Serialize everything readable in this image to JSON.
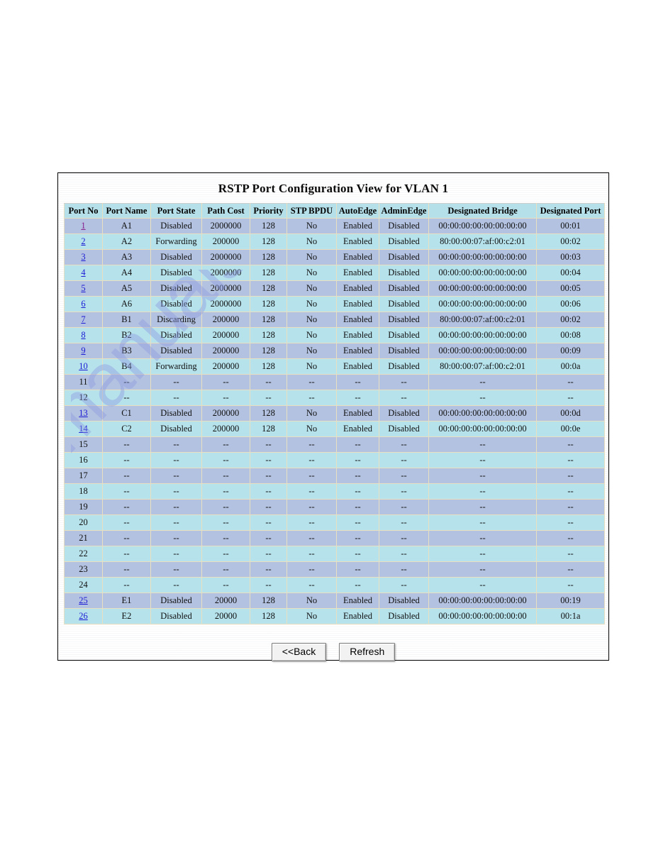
{
  "view": {
    "title": "RSTP Port Configuration View for VLAN 1"
  },
  "watermark": {
    "text": "manualshive.com"
  },
  "table": {
    "columns": [
      "Port No",
      "Port Name",
      "Port State",
      "Path Cost",
      "Priority",
      "STP BPDU",
      "AutoEdge",
      "AdminEdge",
      "Designated Bridge",
      "Designated Port"
    ],
    "empty_value": "--",
    "rows": [
      {
        "port_no": "1",
        "linked": true,
        "visited": true,
        "port_name": "A1",
        "port_state": "Disabled",
        "path_cost": "2000000",
        "priority": "128",
        "stp_bpdu": "No",
        "auto_edge": "Enabled",
        "admin_edge": "Disabled",
        "designated_bridge": "00:00:00:00:00:00:00:00",
        "designated_port": "00:01"
      },
      {
        "port_no": "2",
        "linked": true,
        "visited": false,
        "port_name": "A2",
        "port_state": "Forwarding",
        "path_cost": "200000",
        "priority": "128",
        "stp_bpdu": "No",
        "auto_edge": "Enabled",
        "admin_edge": "Disabled",
        "designated_bridge": "80:00:00:07:af:00:c2:01",
        "designated_port": "00:02"
      },
      {
        "port_no": "3",
        "linked": true,
        "visited": false,
        "port_name": "A3",
        "port_state": "Disabled",
        "path_cost": "2000000",
        "priority": "128",
        "stp_bpdu": "No",
        "auto_edge": "Enabled",
        "admin_edge": "Disabled",
        "designated_bridge": "00:00:00:00:00:00:00:00",
        "designated_port": "00:03"
      },
      {
        "port_no": "4",
        "linked": true,
        "visited": false,
        "port_name": "A4",
        "port_state": "Disabled",
        "path_cost": "2000000",
        "priority": "128",
        "stp_bpdu": "No",
        "auto_edge": "Enabled",
        "admin_edge": "Disabled",
        "designated_bridge": "00:00:00:00:00:00:00:00",
        "designated_port": "00:04"
      },
      {
        "port_no": "5",
        "linked": true,
        "visited": false,
        "port_name": "A5",
        "port_state": "Disabled",
        "path_cost": "2000000",
        "priority": "128",
        "stp_bpdu": "No",
        "auto_edge": "Enabled",
        "admin_edge": "Disabled",
        "designated_bridge": "00:00:00:00:00:00:00:00",
        "designated_port": "00:05"
      },
      {
        "port_no": "6",
        "linked": true,
        "visited": false,
        "port_name": "A6",
        "port_state": "Disabled",
        "path_cost": "2000000",
        "priority": "128",
        "stp_bpdu": "No",
        "auto_edge": "Enabled",
        "admin_edge": "Disabled",
        "designated_bridge": "00:00:00:00:00:00:00:00",
        "designated_port": "00:06"
      },
      {
        "port_no": "7",
        "linked": true,
        "visited": false,
        "port_name": "B1",
        "port_state": "Discarding",
        "path_cost": "200000",
        "priority": "128",
        "stp_bpdu": "No",
        "auto_edge": "Enabled",
        "admin_edge": "Disabled",
        "designated_bridge": "80:00:00:07:af:00:c2:01",
        "designated_port": "00:02"
      },
      {
        "port_no": "8",
        "linked": true,
        "visited": false,
        "port_name": "B2",
        "port_state": "Disabled",
        "path_cost": "200000",
        "priority": "128",
        "stp_bpdu": "No",
        "auto_edge": "Enabled",
        "admin_edge": "Disabled",
        "designated_bridge": "00:00:00:00:00:00:00:00",
        "designated_port": "00:08"
      },
      {
        "port_no": "9",
        "linked": true,
        "visited": false,
        "port_name": "B3",
        "port_state": "Disabled",
        "path_cost": "200000",
        "priority": "128",
        "stp_bpdu": "No",
        "auto_edge": "Enabled",
        "admin_edge": "Disabled",
        "designated_bridge": "00:00:00:00:00:00:00:00",
        "designated_port": "00:09"
      },
      {
        "port_no": "10",
        "linked": true,
        "visited": false,
        "port_name": "B4",
        "port_state": "Forwarding",
        "path_cost": "200000",
        "priority": "128",
        "stp_bpdu": "No",
        "auto_edge": "Enabled",
        "admin_edge": "Disabled",
        "designated_bridge": "80:00:00:07:af:00:c2:01",
        "designated_port": "00:0a"
      },
      {
        "port_no": "11",
        "linked": false,
        "visited": false,
        "port_name": "--",
        "port_state": "--",
        "path_cost": "--",
        "priority": "--",
        "stp_bpdu": "--",
        "auto_edge": "--",
        "admin_edge": "--",
        "designated_bridge": "--",
        "designated_port": "--"
      },
      {
        "port_no": "12",
        "linked": false,
        "visited": false,
        "port_name": "--",
        "port_state": "--",
        "path_cost": "--",
        "priority": "--",
        "stp_bpdu": "--",
        "auto_edge": "--",
        "admin_edge": "--",
        "designated_bridge": "--",
        "designated_port": "--"
      },
      {
        "port_no": "13",
        "linked": true,
        "visited": false,
        "port_name": "C1",
        "port_state": "Disabled",
        "path_cost": "200000",
        "priority": "128",
        "stp_bpdu": "No",
        "auto_edge": "Enabled",
        "admin_edge": "Disabled",
        "designated_bridge": "00:00:00:00:00:00:00:00",
        "designated_port": "00:0d"
      },
      {
        "port_no": "14",
        "linked": true,
        "visited": false,
        "port_name": "C2",
        "port_state": "Disabled",
        "path_cost": "200000",
        "priority": "128",
        "stp_bpdu": "No",
        "auto_edge": "Enabled",
        "admin_edge": "Disabled",
        "designated_bridge": "00:00:00:00:00:00:00:00",
        "designated_port": "00:0e"
      },
      {
        "port_no": "15",
        "linked": false,
        "visited": false,
        "port_name": "--",
        "port_state": "--",
        "path_cost": "--",
        "priority": "--",
        "stp_bpdu": "--",
        "auto_edge": "--",
        "admin_edge": "--",
        "designated_bridge": "--",
        "designated_port": "--"
      },
      {
        "port_no": "16",
        "linked": false,
        "visited": false,
        "port_name": "--",
        "port_state": "--",
        "path_cost": "--",
        "priority": "--",
        "stp_bpdu": "--",
        "auto_edge": "--",
        "admin_edge": "--",
        "designated_bridge": "--",
        "designated_port": "--"
      },
      {
        "port_no": "17",
        "linked": false,
        "visited": false,
        "port_name": "--",
        "port_state": "--",
        "path_cost": "--",
        "priority": "--",
        "stp_bpdu": "--",
        "auto_edge": "--",
        "admin_edge": "--",
        "designated_bridge": "--",
        "designated_port": "--"
      },
      {
        "port_no": "18",
        "linked": false,
        "visited": false,
        "port_name": "--",
        "port_state": "--",
        "path_cost": "--",
        "priority": "--",
        "stp_bpdu": "--",
        "auto_edge": "--",
        "admin_edge": "--",
        "designated_bridge": "--",
        "designated_port": "--"
      },
      {
        "port_no": "19",
        "linked": false,
        "visited": false,
        "port_name": "--",
        "port_state": "--",
        "path_cost": "--",
        "priority": "--",
        "stp_bpdu": "--",
        "auto_edge": "--",
        "admin_edge": "--",
        "designated_bridge": "--",
        "designated_port": "--"
      },
      {
        "port_no": "20",
        "linked": false,
        "visited": false,
        "port_name": "--",
        "port_state": "--",
        "path_cost": "--",
        "priority": "--",
        "stp_bpdu": "--",
        "auto_edge": "--",
        "admin_edge": "--",
        "designated_bridge": "--",
        "designated_port": "--"
      },
      {
        "port_no": "21",
        "linked": false,
        "visited": false,
        "port_name": "--",
        "port_state": "--",
        "path_cost": "--",
        "priority": "--",
        "stp_bpdu": "--",
        "auto_edge": "--",
        "admin_edge": "--",
        "designated_bridge": "--",
        "designated_port": "--"
      },
      {
        "port_no": "22",
        "linked": false,
        "visited": false,
        "port_name": "--",
        "port_state": "--",
        "path_cost": "--",
        "priority": "--",
        "stp_bpdu": "--",
        "auto_edge": "--",
        "admin_edge": "--",
        "designated_bridge": "--",
        "designated_port": "--"
      },
      {
        "port_no": "23",
        "linked": false,
        "visited": false,
        "port_name": "--",
        "port_state": "--",
        "path_cost": "--",
        "priority": "--",
        "stp_bpdu": "--",
        "auto_edge": "--",
        "admin_edge": "--",
        "designated_bridge": "--",
        "designated_port": "--"
      },
      {
        "port_no": "24",
        "linked": false,
        "visited": false,
        "port_name": "--",
        "port_state": "--",
        "path_cost": "--",
        "priority": "--",
        "stp_bpdu": "--",
        "auto_edge": "--",
        "admin_edge": "--",
        "designated_bridge": "--",
        "designated_port": "--"
      },
      {
        "port_no": "25",
        "linked": true,
        "visited": false,
        "port_name": "E1",
        "port_state": "Disabled",
        "path_cost": "20000",
        "priority": "128",
        "stp_bpdu": "No",
        "auto_edge": "Enabled",
        "admin_edge": "Disabled",
        "designated_bridge": "00:00:00:00:00:00:00:00",
        "designated_port": "00:19"
      },
      {
        "port_no": "26",
        "linked": true,
        "visited": false,
        "port_name": "E2",
        "port_state": "Disabled",
        "path_cost": "20000",
        "priority": "128",
        "stp_bpdu": "No",
        "auto_edge": "Enabled",
        "admin_edge": "Disabled",
        "designated_bridge": "00:00:00:00:00:00:00:00",
        "designated_port": "00:1a"
      }
    ]
  },
  "buttons": {
    "back_label": "<<Back",
    "refresh_label": "Refresh"
  },
  "colors": {
    "row_odd": "#b3c2e0",
    "row_even": "#b6e2ec",
    "header": "#b5dfe9",
    "grid_line": "#e9e0c2",
    "link": "#1b1bd4",
    "link_visited": "#871f8e"
  }
}
